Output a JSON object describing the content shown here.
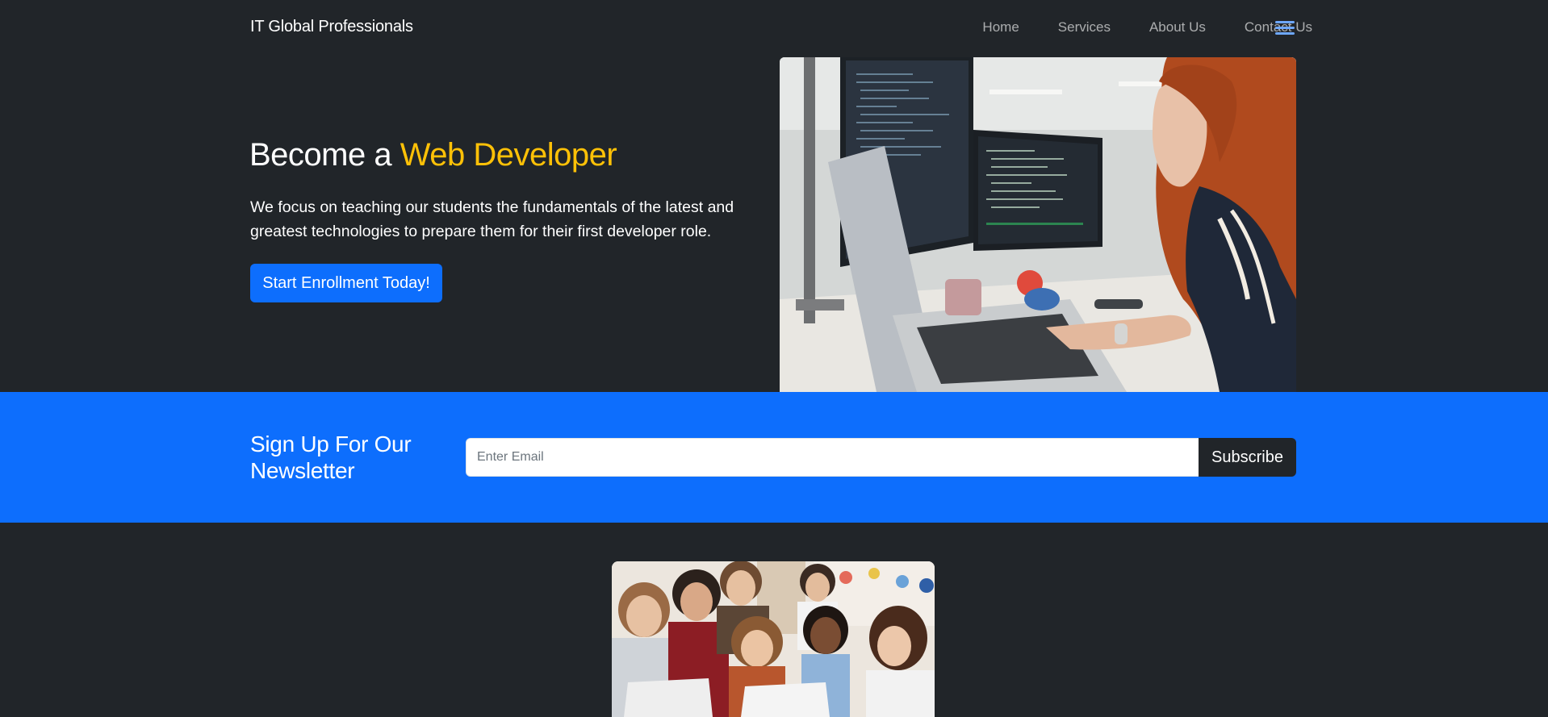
{
  "navbar": {
    "brand": "IT Global Professionals",
    "links": [
      "Home",
      "Services",
      "About Us",
      "Contact Us"
    ],
    "menu_icon": "hamburger-menu-icon"
  },
  "hero": {
    "title_prefix": "Become a ",
    "title_accent": "Web Developer",
    "text": "We focus on teaching our students the fundamentals of the latest and greatest technologies to prepare them for their first developer role.",
    "button_label": "Start Enrollment Today!",
    "image": "woman-coding-at-computer-photo"
  },
  "newsletter": {
    "title": "Sign Up For Our Newsletter",
    "input_placeholder": "Enter Email",
    "button_label": "Subscribe"
  },
  "bottom": {
    "image": "students-with-laptops-photo"
  },
  "colors": {
    "background": "#212529",
    "primary": "#0d6efd",
    "accent": "#ffc107",
    "menu_icon": "#6ea8fe"
  }
}
